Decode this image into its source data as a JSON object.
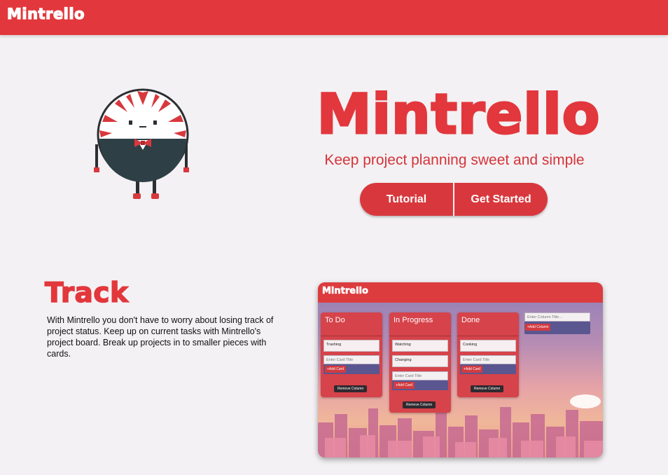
{
  "header": {
    "brand": "Mintrello"
  },
  "hero": {
    "title": "Mintrello",
    "tagline": "Keep project planning sweet and simple",
    "buttons": {
      "tutorial": "Tutorial",
      "get_started": "Get Started"
    }
  },
  "mascot": {
    "icon": "peppermint-mascot-icon"
  },
  "feature": {
    "title": "Track",
    "body": "With Mintrello you don't have to worry about losing track of project status. Keep up on current tasks with Mintrello's project board. Break up projects in to smaller pieces with cards."
  },
  "preview": {
    "brand": "Mintrello",
    "columns": [
      {
        "title": "To Do",
        "cards": [
          "Trashing"
        ]
      },
      {
        "title": "In Progress",
        "cards": [
          "Watching",
          "Changing"
        ]
      },
      {
        "title": "Done",
        "cards": [
          "Cooking"
        ]
      }
    ],
    "card_placeholder": "Enter Card Title",
    "add_card_label": "+Add Card",
    "remove_column_label": "Remove Column",
    "column_placeholder": "Enter Column Title...",
    "add_column_label": "+Add Column"
  },
  "colors": {
    "brand_red": "#e2373c",
    "page_bg": "#f3f1f3",
    "column_entry": "#5a5690"
  }
}
